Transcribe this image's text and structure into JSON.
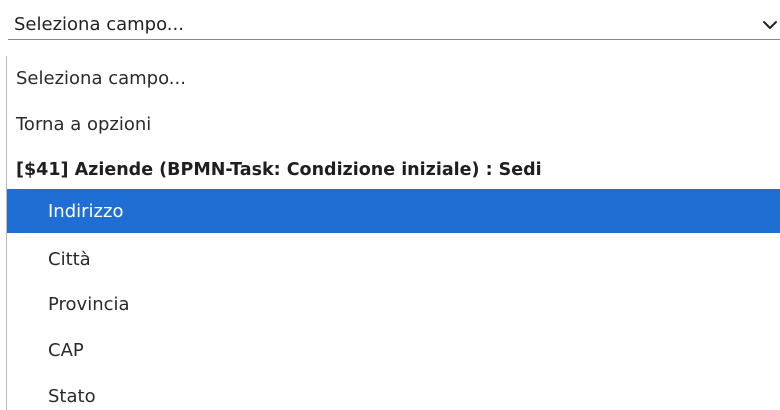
{
  "select": {
    "value": "Seleziona campo...",
    "icon": "chevron-down-icon"
  },
  "dropdown": {
    "options": [
      {
        "label": "Seleziona campo..."
      },
      {
        "label": "Torna a opzioni"
      }
    ],
    "group": {
      "label": "[$41] Aziende (BPMN-Task: Condizione iniziale) : Sedi",
      "items": [
        {
          "label": "Indirizzo",
          "selected": true
        },
        {
          "label": "Città"
        },
        {
          "label": "Provincia"
        },
        {
          "label": "CAP"
        },
        {
          "label": "Stato"
        }
      ]
    },
    "selected_color": "#1f6ed4"
  }
}
